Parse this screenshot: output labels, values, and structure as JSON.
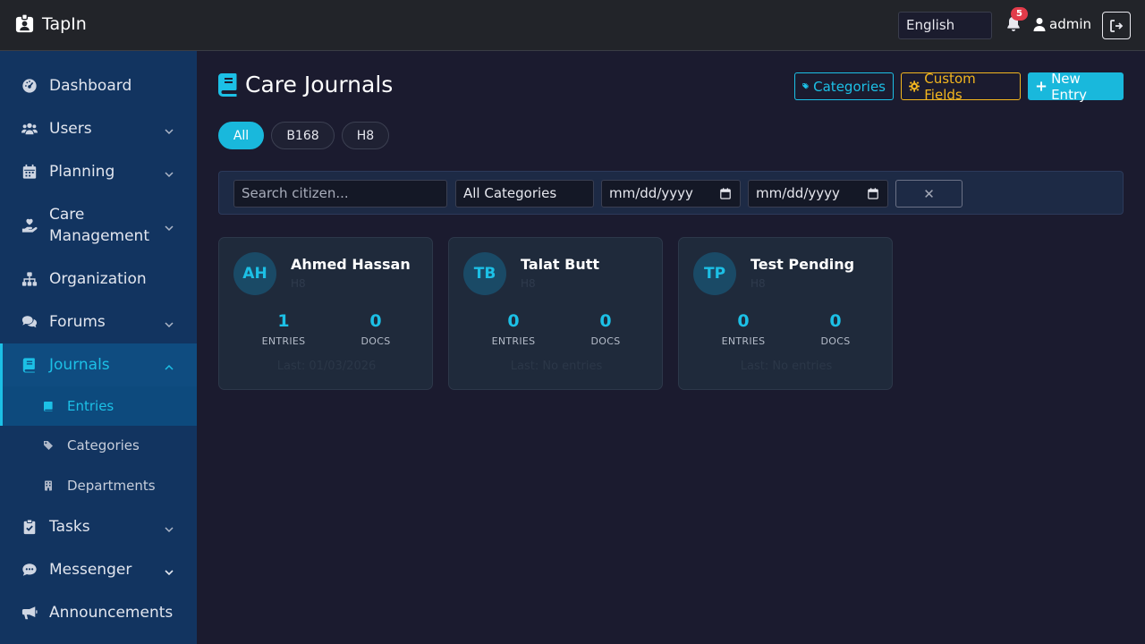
{
  "header": {
    "brand": "TapIn",
    "language": "English",
    "notifications_count": "5",
    "user": "admin"
  },
  "sidebar": {
    "items": [
      {
        "label": "Dashboard"
      },
      {
        "label": "Users"
      },
      {
        "label": "Planning"
      },
      {
        "label": "Care Management"
      },
      {
        "label": "Organization"
      },
      {
        "label": "Forums"
      },
      {
        "label": "Journals"
      },
      {
        "label": "Tasks"
      },
      {
        "label": "Messenger"
      },
      {
        "label": "Announcements"
      }
    ],
    "journal_sub": [
      {
        "label": "Entries"
      },
      {
        "label": "Categories"
      },
      {
        "label": "Departments"
      }
    ]
  },
  "main": {
    "title": "Care Journals",
    "buttons": {
      "categories": "Categories",
      "custom_fields": "Custom Fields",
      "new_entry": "New Entry"
    },
    "tabs": [
      {
        "label": "All"
      },
      {
        "label": "B168"
      },
      {
        "label": "H8"
      }
    ],
    "filters": {
      "search_placeholder": "Search citizen...",
      "category": "All Categories",
      "date_from": "mm/dd/yyyy",
      "date_to": "mm/dd/yyyy",
      "clear": "✕"
    },
    "cards": [
      {
        "initials": "AH",
        "name": "Ahmed Hassan",
        "dept": "H8",
        "entries": "1",
        "docs": "0",
        "entries_label": "ENTRIES",
        "docs_label": "DOCS",
        "last": "Last: 01/03/2026"
      },
      {
        "initials": "TB",
        "name": "Talat Butt",
        "dept": "H8",
        "entries": "0",
        "docs": "0",
        "entries_label": "ENTRIES",
        "docs_label": "DOCS",
        "last": "Last: No entries"
      },
      {
        "initials": "TP",
        "name": "Test Pending",
        "dept": "H8",
        "entries": "0",
        "docs": "0",
        "entries_label": "ENTRIES",
        "docs_label": "DOCS",
        "last": "Last: No entries"
      }
    ]
  }
}
